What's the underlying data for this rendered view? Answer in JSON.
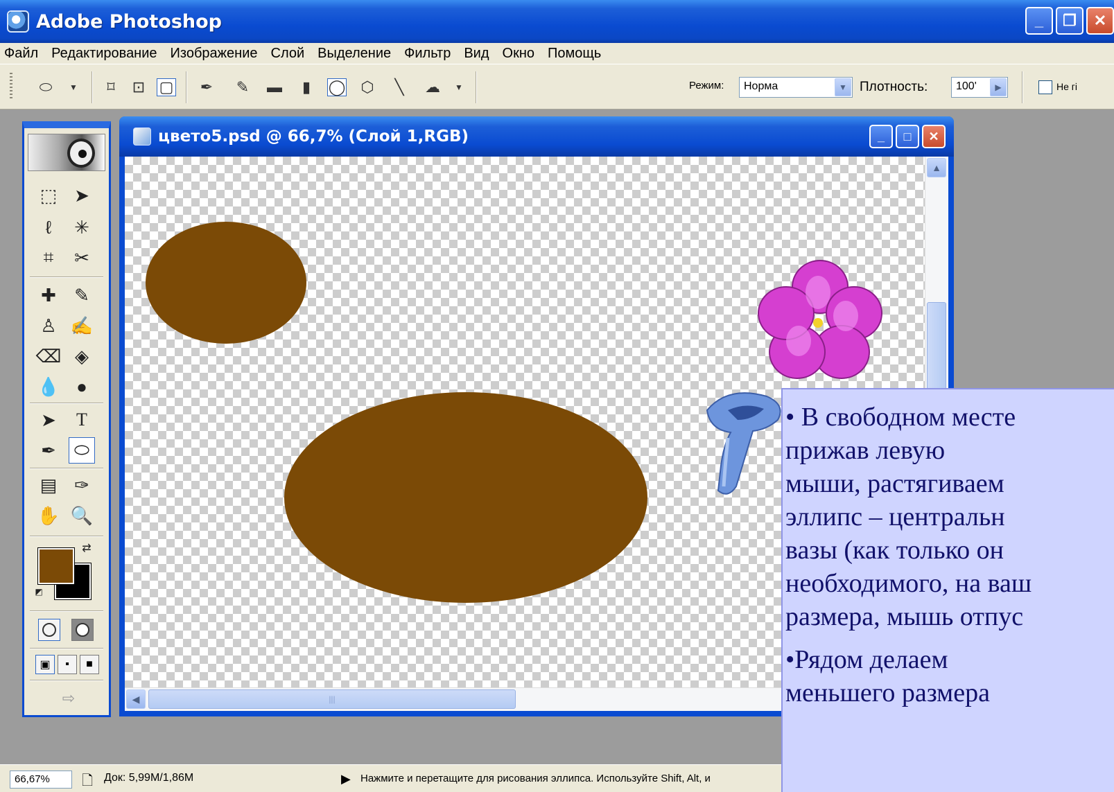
{
  "app": {
    "title": "Adobe Photoshop",
    "window_buttons": [
      "_",
      "❐",
      "✕"
    ]
  },
  "menu": [
    "Файл",
    "Редактирование",
    "Изображение",
    "Слой",
    "Выделение",
    "Фильтр",
    "Вид",
    "Окно",
    "Помощь"
  ],
  "options": {
    "mode_label": "Режим:",
    "mode_value": "Норма",
    "opacity_label": "Плотность:",
    "opacity_value": "100'",
    "checkbox_label": "Не гі"
  },
  "document": {
    "title": "цвето5.psd @ 66,7% (Слой 1,RGB)",
    "fill_color": "#7b4a06"
  },
  "toolbox": {
    "foreground_color": "#7b4a06",
    "background_color": "#000000"
  },
  "status": {
    "zoom": "66,67%",
    "doc_info": "Док: 5,99М/1,86М",
    "message": "Нажмите и перетащите для рисования эллипса. Используйте Shift, Alt, и"
  },
  "note": {
    "lines": [
      "• В свободном месте",
      "прижав        левую",
      "мыши, растягиваем",
      "эллипс – центральн",
      "вазы (как только он",
      "необходимого, на ваш",
      "размера, мышь отпус"
    ],
    "lines2": [
      "•Рядом        делаем",
      "меньшего        размера"
    ]
  }
}
